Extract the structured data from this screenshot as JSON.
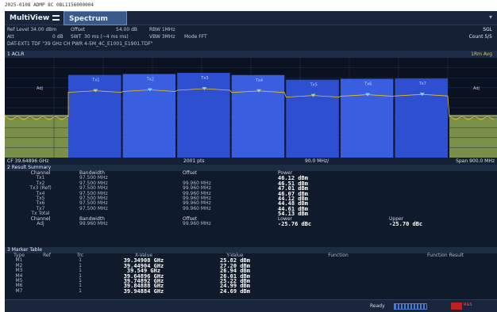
{
  "top_line": "2025-0108 ADMP 8C 0BL1156000004",
  "tabs": {
    "multiview": "MultiView",
    "spectrum": "Spectrum"
  },
  "params": {
    "ref_level": "Ref Level 34.00 dBm",
    "offset": "Offset",
    "offset_val": "54.00 dB",
    "rbw": "RBW 1MHz",
    "att": "Att",
    "att_val": "0 dB",
    "swt": "SWT",
    "swt_val": "30 ms (~4 ms ms)",
    "vbw": "VBW 3MHz",
    "mode": "Mode FFT",
    "line3": "DAT-EXT1 TDF \"39 GHz CH PWR 4-5M_4C_E1001_E1901.TDF\"",
    "sgl": "SGL",
    "count": "Count 5/5"
  },
  "window_title": "1 ACLR",
  "trace_label": "1Rm Avg",
  "axis": {
    "cf": "CF 39.64896 GHz",
    "pts": "2001 pts",
    "div": "90.0 MHz/",
    "span": "Span 900.0 MHz"
  },
  "chart_data": {
    "type": "line",
    "title": "",
    "xlabel": "",
    "ylabel": "",
    "channels": [
      "Tx1",
      "Tx2",
      "Tx3",
      "Tx4",
      "Tx5",
      "Tx6",
      "Tx7"
    ],
    "adjacent": [
      "Adj",
      "Adj"
    ],
    "level_dbm": [
      46.12,
      46.51,
      47.01,
      46.07,
      44.12,
      44.48,
      44.61
    ]
  },
  "result_summary": {
    "title": "2 Result Summary",
    "head": [
      "Channel",
      "Bandwidth",
      "Offset",
      "Power"
    ],
    "rows": [
      [
        "Tx1",
        "97.500 MHz",
        "",
        "46.12 dBm"
      ],
      [
        "Tx2",
        "97.500 MHz",
        "99.960 MHz",
        "46.51 dBm"
      ],
      [
        "Tx3 (Ref)",
        "97.500 MHz",
        "99.960 MHz",
        "47.01 dBm"
      ],
      [
        "Tx4",
        "97.500 MHz",
        "99.960 MHz",
        "46.07 dBm"
      ],
      [
        "Tx5",
        "97.500 MHz",
        "99.960 MHz",
        "44.12 dBm"
      ],
      [
        "Tx6",
        "97.500 MHz",
        "99.960 MHz",
        "44.48 dBm"
      ],
      [
        "Tx7",
        "97.500 MHz",
        "99.960 MHz",
        "44.61 dBm"
      ],
      [
        "Tx Total",
        "",
        "",
        "54.13 dBm"
      ]
    ],
    "adj_head": [
      "Channel",
      "Bandwidth",
      "Offset",
      "Lower",
      "Upper"
    ],
    "adj_row": [
      "Adj",
      "99.960 MHz",
      "99.960 MHz",
      "-25.76 dBc",
      "-25.70 dBc"
    ]
  },
  "marker_table": {
    "title": "3 Marker Table",
    "head": [
      "Type",
      "Ref",
      "Trc",
      "X-Value",
      "Y-Value",
      "Function",
      "Function Result"
    ],
    "rows": [
      [
        "M1",
        "",
        "1",
        "39.34908 GHz",
        "25.82 dBm"
      ],
      [
        "M2",
        "",
        "1",
        "39.44904 GHz",
        "27.20 dBm"
      ],
      [
        "M3",
        "",
        "1",
        "39.549 GHz",
        "26.94 dBm"
      ],
      [
        "M4",
        "",
        "1",
        "39.64896 GHz",
        "26.01 dBm"
      ],
      [
        "M5",
        "",
        "1",
        "39.74892 GHz",
        "25.22 dBm"
      ],
      [
        "M6",
        "",
        "1",
        "39.84888 GHz",
        "24.99 dBm"
      ],
      [
        "M7",
        "",
        "1",
        "39.94884 GHz",
        "24.69 dBm"
      ]
    ]
  },
  "status": {
    "ready": "Ready"
  },
  "colors": {
    "channel_fill": "#2e4fcf",
    "channel_alt": "#3a5ee0",
    "noise": "#7a8f4a",
    "trace": "#f0c020"
  }
}
